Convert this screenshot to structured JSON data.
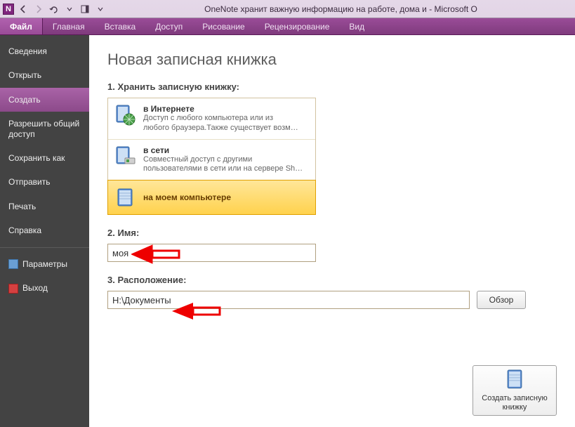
{
  "titlebar": {
    "title": "OneNote хранит важную информацию на работе, дома и  -  Microsoft O"
  },
  "ribbon": {
    "file": "Файл",
    "tabs": [
      "Главная",
      "Вставка",
      "Доступ",
      "Рисование",
      "Рецензирование",
      "Вид"
    ]
  },
  "sidebar": {
    "items": [
      {
        "label": "Сведения"
      },
      {
        "label": "Открыть"
      },
      {
        "label": "Создать"
      },
      {
        "label": "Разрешить общий доступ"
      },
      {
        "label": "Сохранить как"
      },
      {
        "label": "Отправить"
      },
      {
        "label": "Печать"
      },
      {
        "label": "Справка"
      }
    ],
    "params": "Параметры",
    "exit": "Выход"
  },
  "content": {
    "heading": "Новая записная книжка",
    "section1": "1. Хранить записную книжку:",
    "storage": [
      {
        "title": "в Интернете",
        "desc1": "Доступ с любого компьютера или из",
        "desc2": "любого браузера.Также существует возм…"
      },
      {
        "title": "в сети",
        "desc1": "Совместный доступ с другими",
        "desc2": "пользователями в сети или на сервере Sh…"
      },
      {
        "title": "на моем компьютере",
        "desc1": "",
        "desc2": ""
      }
    ],
    "section2": "2. Имя:",
    "name_value": "моя",
    "section3": "3. Расположение:",
    "path_value": "H:\\Документы",
    "browse": "Обзор",
    "create": "Создать записную книжку"
  }
}
